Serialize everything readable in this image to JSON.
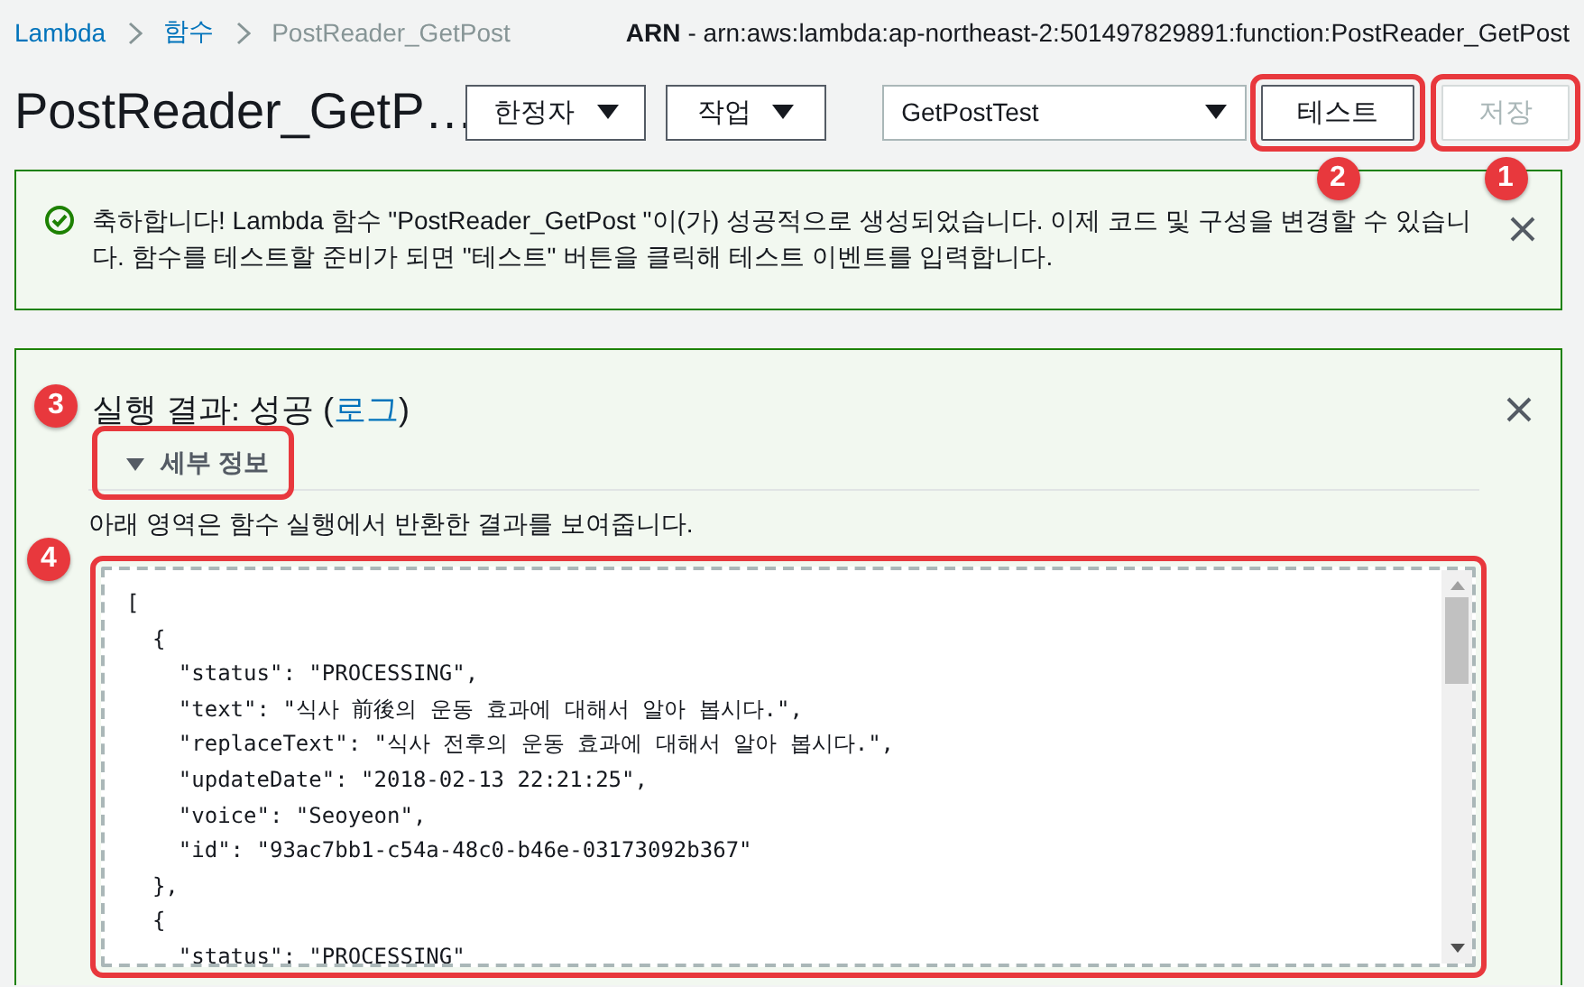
{
  "breadcrumb": [
    {
      "label": "Lambda",
      "kind": "link"
    },
    {
      "label": "함수",
      "kind": "link"
    },
    {
      "label": "PostReader_GetPost",
      "kind": "current"
    }
  ],
  "arn": {
    "label": "ARN",
    "value": "- arn:aws:lambda:ap-northeast-2:501497829891:function:PostReader_GetPost"
  },
  "title": "PostReader_GetP…",
  "menus": [
    {
      "label": "한정자"
    },
    {
      "label": "작업"
    }
  ],
  "test_event": {
    "value": "GetPostTest"
  },
  "buttons": [
    {
      "label": "테스트",
      "disabled": false,
      "highlighted": true,
      "badge": "2"
    },
    {
      "label": "저장",
      "disabled": true,
      "highlighted": true,
      "badge": "1"
    }
  ],
  "notice": {
    "text": "축하합니다! Lambda 함수 \"PostReader_GetPost \"이(가) 성공적으로 생성되었습니다.  이제 코드 및 구성을 변경할 수 있습니다. 함수를 테스트할 준비가 되면 \"테스트\" 버튼을 클릭해 테스트 이벤트를 입력합니다."
  },
  "result": {
    "title": "실행 결과: 성공 (",
    "log_link": "로그",
    "title_end": ")"
  },
  "details": {
    "label": "세부 정보",
    "expanded": true,
    "highlighted": true,
    "badge": "3"
  },
  "description": "아래 영역은 함수 실행에서 반환한 결과를 보여줍니다.",
  "output": {
    "highlighted": true,
    "badge": "4",
    "lines": [
      "[",
      "  {",
      "    \"status\": \"PROCESSING\",",
      "    \"text\": \"식사 前後의 운동 효과에 대해서 알아 봅시다.\",",
      "    \"replaceText\": \"식사 전후의 운동 효과에 대해서 알아 봅시다.\",",
      "    \"updateDate\": \"2018-02-13 22:21:25\",",
      "    \"voice\": \"Seoyeon\",",
      "    \"id\": \"93ac7bb1-c54a-48c0-b46e-03173092b367\"",
      "  },",
      "  {",
      "    \"status\": \"PROCESSING\""
    ]
  }
}
